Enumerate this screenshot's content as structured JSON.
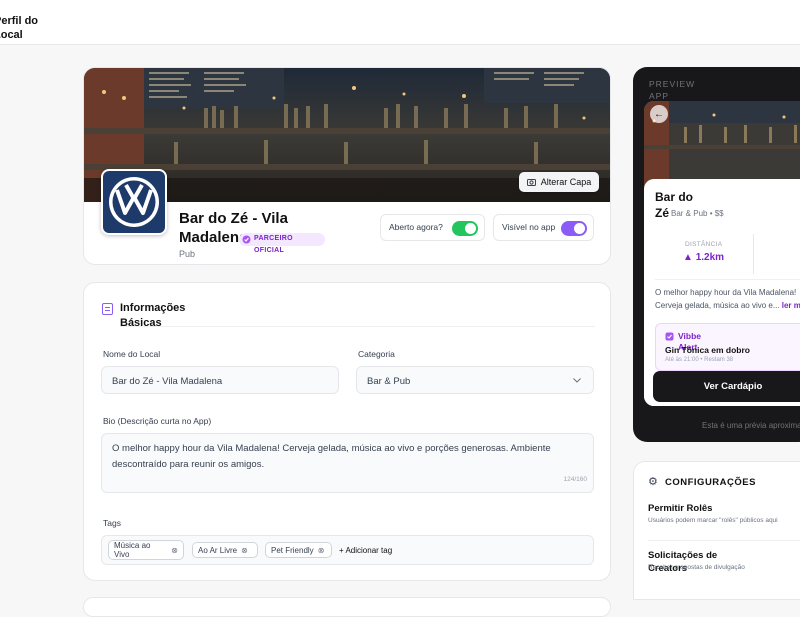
{
  "header": {
    "page_title": "Perfil do Local"
  },
  "profile": {
    "change_cover_label": "Alterar Capa",
    "name": "Bar do Zé - Vila Madalena",
    "type": "Pub",
    "badge": "PARCEIRO OFICIAL",
    "open_now_label": "Aberto agora?",
    "open_now": true,
    "visible_label": "Visível no app",
    "visible": true
  },
  "info": {
    "section_title": "Informações Básicas",
    "name_label": "Nome do Local",
    "name_value": "Bar do Zé - Vila Madalena",
    "category_label": "Categoria",
    "category_value": "Bar & Pub",
    "bio_label": "Bio (Descrição curta no App)",
    "bio_value": "O melhor happy hour da Vila Madalena! Cerveja gelada, música ao vivo e porções generosas. Ambiente descontraído para reunir os amigos.",
    "bio_counter": "124/160",
    "tags_label": "Tags",
    "tags": [
      "Música ao Vivo",
      "Ao Ar Livre",
      "Pet Friendly"
    ],
    "add_tag_label": "+ Adicionar tag"
  },
  "preview": {
    "label": "PREVIEW APP",
    "name": "Bar do Zé",
    "meta": "Bar & Pub • $$",
    "distance_label": "DISTÂNCIA",
    "distance_value": "1.2km",
    "description": "O melhor happy hour da Vila Madalena! Cerveja gelada, música ao vivo e...",
    "read_more": "ler mais",
    "promo_header": "Vibbe Alert",
    "promo_title": "Gin Tônica em dobro",
    "promo_sub": "Até às 21:00 • Restam 38",
    "cta": "Ver Cardápio",
    "caption": "Esta é uma prévia aproximada"
  },
  "config": {
    "title": "CONFIGURAÇÕES",
    "items": [
      {
        "title": "Permitir Rolês",
        "desc": "Usuários podem marcar \"rolês\" públicos aqui"
      },
      {
        "title": "Solicitações de Creators",
        "desc": "Receber propostas de divulgação"
      }
    ]
  },
  "colors": {
    "accent": "#8b5cf6",
    "toggle_on": "#22c55e",
    "dark": "#18181b"
  }
}
